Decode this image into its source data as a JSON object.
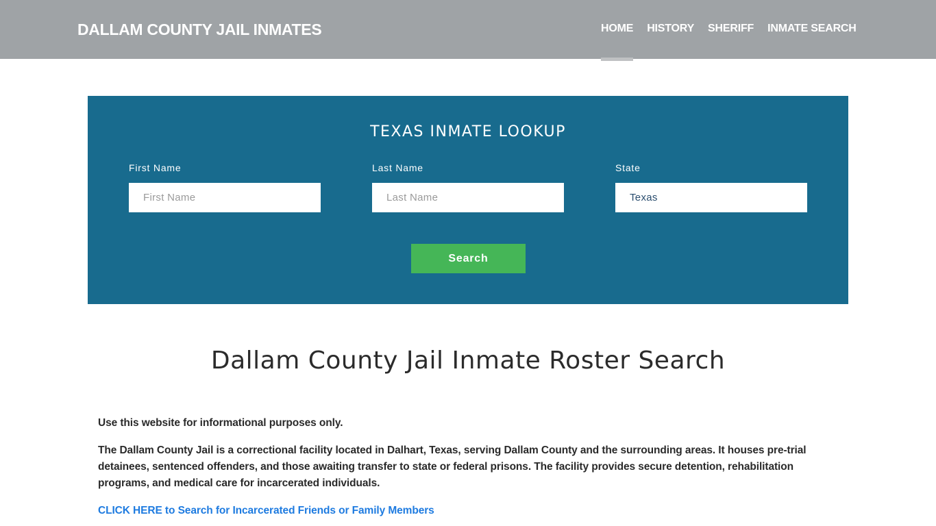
{
  "header": {
    "brand": "DALLAM COUNTY JAIL INMATES",
    "nav": [
      {
        "label": "HOME",
        "active": true
      },
      {
        "label": "HISTORY",
        "active": false
      },
      {
        "label": "SHERIFF",
        "active": false
      },
      {
        "label": "INMATE SEARCH",
        "active": false
      }
    ]
  },
  "lookup": {
    "title": "TEXAS INMATE LOOKUP",
    "first_name": {
      "label": "First Name",
      "placeholder": "First Name",
      "value": ""
    },
    "last_name": {
      "label": "Last Name",
      "placeholder": "Last Name",
      "value": ""
    },
    "state": {
      "label": "State",
      "value": "Texas"
    },
    "search_label": "Search",
    "colors": {
      "panel": "#186b8e",
      "button": "#45b657"
    }
  },
  "main": {
    "title": "Dallam County Jail Inmate Roster Search",
    "disclaimer": "Use this website for informational purposes only.",
    "description": "The Dallam County Jail is a correctional facility located in Dalhart, Texas, serving Dallam County and the surrounding areas. It houses pre-trial detainees, sentenced offenders, and those awaiting transfer to state or federal prisons. The facility provides secure detention, rehabilitation programs, and medical care for incarcerated individuals.",
    "cta_link": "CLICK HERE to Search for Incarcerated Friends or Family Members",
    "link_color": "#1e7be0"
  }
}
